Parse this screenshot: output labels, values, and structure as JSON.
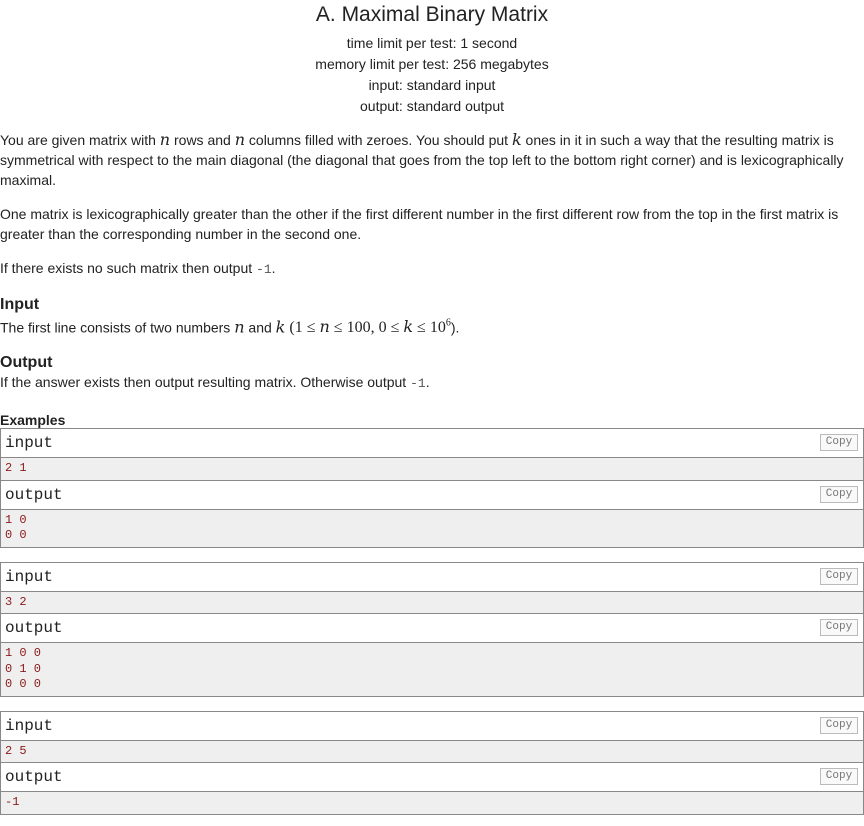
{
  "problem": {
    "title": "A. Maximal Binary Matrix",
    "time_limit": "time limit per test: 1 second",
    "memory_limit": "memory limit per test: 256 megabytes",
    "input_file": "input: standard input",
    "output_file": "output: standard output"
  },
  "statement": {
    "p1_a": "You are given matrix with ",
    "p1_var_n1": "n",
    "p1_b": " rows and ",
    "p1_var_n2": "n",
    "p1_c": " columns filled with zeroes. You should put ",
    "p1_var_k": "k",
    "p1_d": " ones in it in such a way that the resulting matrix is symmetrical with respect to the main diagonal (the diagonal that goes from the top left to the bottom right corner) and is lexicographically maximal.",
    "p2": "One matrix is lexicographically greater than the other if the first different number in the first different row from the top in the first matrix is greater than the corresponding number in the second one.",
    "p3_a": "If there exists no such matrix then output ",
    "p3_code": "-1",
    "p3_b": "."
  },
  "input_section": {
    "title": "Input",
    "text_a": "The first line consists of two numbers ",
    "var_n": "n",
    "text_b": " and ",
    "var_k": "k",
    "constraint_open": " (1 ≤ ",
    "constraint_n": "n",
    "constraint_mid": " ≤ 100, 0 ≤ ",
    "constraint_k": "k",
    "constraint_le": " ≤ 10",
    "constraint_exp": "6",
    "constraint_close": ")."
  },
  "output_section": {
    "title": "Output",
    "text_a": "If the answer exists then output resulting matrix. Otherwise output ",
    "code": "-1",
    "text_b": "."
  },
  "examples": {
    "title": "Examples",
    "input_label": "input",
    "output_label": "output",
    "copy_label": "Copy",
    "tests": [
      {
        "input": "2 1",
        "output": "1 0\n0 0"
      },
      {
        "input": "3 2",
        "output": "1 0 0\n0 1 0\n0 0 0"
      },
      {
        "input": "2 5",
        "output": "-1"
      }
    ]
  }
}
